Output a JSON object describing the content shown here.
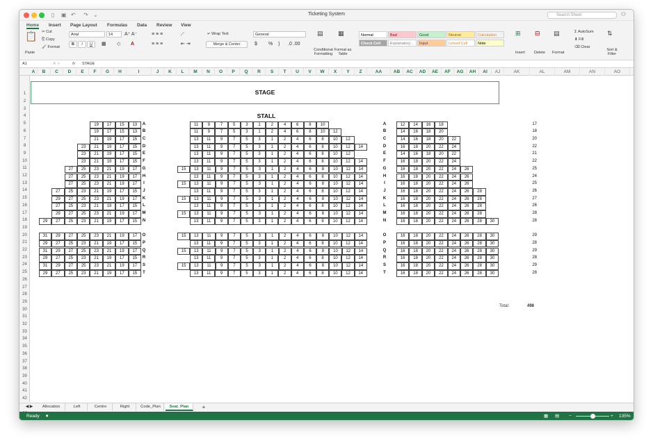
{
  "window_title": "Ticketing System",
  "search_placeholder": "Search Sheet",
  "tabs": [
    "Home",
    "Insert",
    "Page Layout",
    "Formulas",
    "Data",
    "Review",
    "View"
  ],
  "ribbon": {
    "paste": "Paste",
    "cut": "Cut",
    "copy": "Copy",
    "format": "Format",
    "font": "Arial",
    "size": "14",
    "bold": "B",
    "italic": "I",
    "underline": "U",
    "wrap": "Wrap Text",
    "merge": "Merge & Center",
    "number_format": "General",
    "percent": "%",
    "comma": ")",
    "conditional": "Conditional Formatting",
    "format_table": "Format as Table",
    "insert": "Insert",
    "delete": "Delete",
    "format_cells": "Format",
    "autosum": "AutoSum",
    "fill": "Fill",
    "clear": "Clear",
    "sort": "Sort & Filter"
  },
  "styles": [
    [
      "Normal",
      "#ffffff",
      "#000000"
    ],
    [
      "Bad",
      "#ffc7ce",
      "#9c0006"
    ],
    [
      "Good",
      "#c6efce",
      "#006100"
    ],
    [
      "Neutral",
      "#ffeb9c",
      "#9c5700"
    ],
    [
      "Calculation",
      "#f2f2f2",
      "#fa7d00"
    ],
    [
      "Check Cell",
      "#a5a5a5",
      "#ffffff"
    ],
    [
      "Explanatory...",
      "#ffffff",
      "#7f7f7f"
    ],
    [
      "Input",
      "#ffcc99",
      "#3f3f76"
    ],
    [
      "Linked Cell",
      "#ffffff",
      "#fa7d00"
    ],
    [
      "Note",
      "#ffffcc",
      "#000000"
    ]
  ],
  "formula_bar": {
    "cell": "A1",
    "fx": "fx",
    "value": "STAGE"
  },
  "columns": [
    "A",
    "B",
    "C",
    "D",
    "E",
    "F",
    "G",
    "H",
    "I",
    "J",
    "K",
    "L",
    "M",
    "N",
    "O",
    "P",
    "Q",
    "R",
    "S",
    "T",
    "U",
    "V",
    "W",
    "X",
    "Y",
    "Z",
    "AA",
    "AB",
    "AC",
    "AD",
    "AE",
    "AF",
    "AG",
    "AH",
    "AI",
    "AJ",
    "AK",
    "AL",
    "AM",
    "AN",
    "AO"
  ],
  "row_count": 44,
  "stage": "STAGE",
  "stall": "STALL",
  "rows": [
    [
      "A",
      "19 17 15 13",
      "11 9 7 5 3 1 2 4 6 8 10",
      "12 14 16 18",
      "17"
    ],
    [
      "B",
      "19 17 15 13",
      "11 9 7 5 3 1 2 4 6 8 10 12",
      "14 16 18 20",
      "18"
    ],
    [
      "C",
      "21 19 17 15",
      "13 11 9 7 5 3 1 2 4 6 8 10 12",
      "14 16 18 20 22",
      "20"
    ],
    [
      "D",
      "23 21 19 17 15",
      "13 11 9 7 5 3 1 2 4 6 8 10 12 14",
      "16 18 20 22 24",
      "22"
    ],
    [
      "E",
      "23 21 19 17 15",
      "13 11 9 7 5 3 1 2 4 6 8 10 12",
      "14 16 18 20 22",
      "21"
    ],
    [
      "F",
      "23 21 19 17 15",
      "13 11 9 7 5 3 1 2 4 6 8 10 12 14",
      "16 18 20 22 24",
      "22"
    ],
    [
      "G",
      "27 25 23 21 19 17",
      "15 13 11 9 7 5 3 1 2 4 6 8 10 12 14",
      "16 18 20 22 24 26",
      "25"
    ],
    [
      "H",
      "27 25 23 21 19 17",
      "13 11 9 7 5 3 1 2 4 6 8 10 12 14",
      "16 18 20 22 24 26",
      "24"
    ],
    [
      "I",
      "27 25 23 21 19 17",
      "15 13 11 9 7 5 3 1 2 4 6 8 10 12 14",
      "16 18 20 22 24 26",
      "25"
    ],
    [
      "J",
      "27 25 23 21 19 17 15",
      "13 11 9 7 5 3 1 2 4 6 8 10 12 14",
      "16 18 20 22 24 26 28",
      "26"
    ],
    [
      "K",
      "29 27 25 23 21 19 17",
      "15 13 11 9 7 5 3 1 2 4 6 8 10 12 14",
      "16 18 20 22 24 26 28",
      "27"
    ],
    [
      "L",
      "27 25 23 21 19 17 15",
      "13 11 9 7 5 3 1 2 4 6 8 10 12 14",
      "16 18 20 22 24 26 28",
      "26"
    ],
    [
      "M",
      "29 27 25 23 21 19 17",
      "15 13 11 9 7 5 3 1 2 4 6 8 10 12 14",
      "16 18 20 22 24 26 28",
      "28"
    ],
    [
      "N",
      "29 27 25 23 21 19 17 15",
      "13 11 9 7 5 3 1 2 4 6 8 10 12 14",
      "16 18 20 22 24 26 28 30",
      "28"
    ],
    null,
    [
      "O",
      "31 29 27 25 23 21 19 17",
      "15 13 11 9 7 5 3 1 2 4 6 8 10 12 14",
      "16 18 20 22 24 26 28 30",
      "29"
    ],
    [
      "P",
      "29 27 25 23 21 19 17 15",
      "13 11 9 7 5 3 1 2 4 6 8 10 12 14",
      "16 18 20 22 24 26 28 30",
      "28"
    ],
    [
      "Q",
      "31 29 27 25 23 21 19 17",
      "15 13 11 9 7 5 3 1 2 4 6 8 10 12 14",
      "16 18 20 22 24 26 28 30",
      "29"
    ],
    [
      "R",
      "29 27 25 23 21 19 17 15",
      "13 11 9 7 5 3 1 2 4 6 8 10 12 14",
      "16 18 20 22 24 26 28 30",
      "28"
    ],
    [
      "S",
      "31 29 27 25 23 21 19 17",
      "15 13 11 9 7 5 3 1 2 4 6 8 10 12 14",
      "16 18 20 22 24 26 28 30",
      "29"
    ],
    [
      "T",
      "29 27 25 23 21 19 17 15",
      "13 11 9 7 5 3 1 2 4 6 8 10 12 14",
      "16 18 20 22 24 26 28 30",
      "28"
    ]
  ],
  "total_label": "Total:",
  "total_value": "498",
  "sheet_tabs": [
    "Allocation",
    "Left",
    "Centre",
    "Right",
    "Code_Plan",
    "Seat_Plan"
  ],
  "active_sheet": "Seat_Plan",
  "status": "Ready",
  "zoom": "135%"
}
